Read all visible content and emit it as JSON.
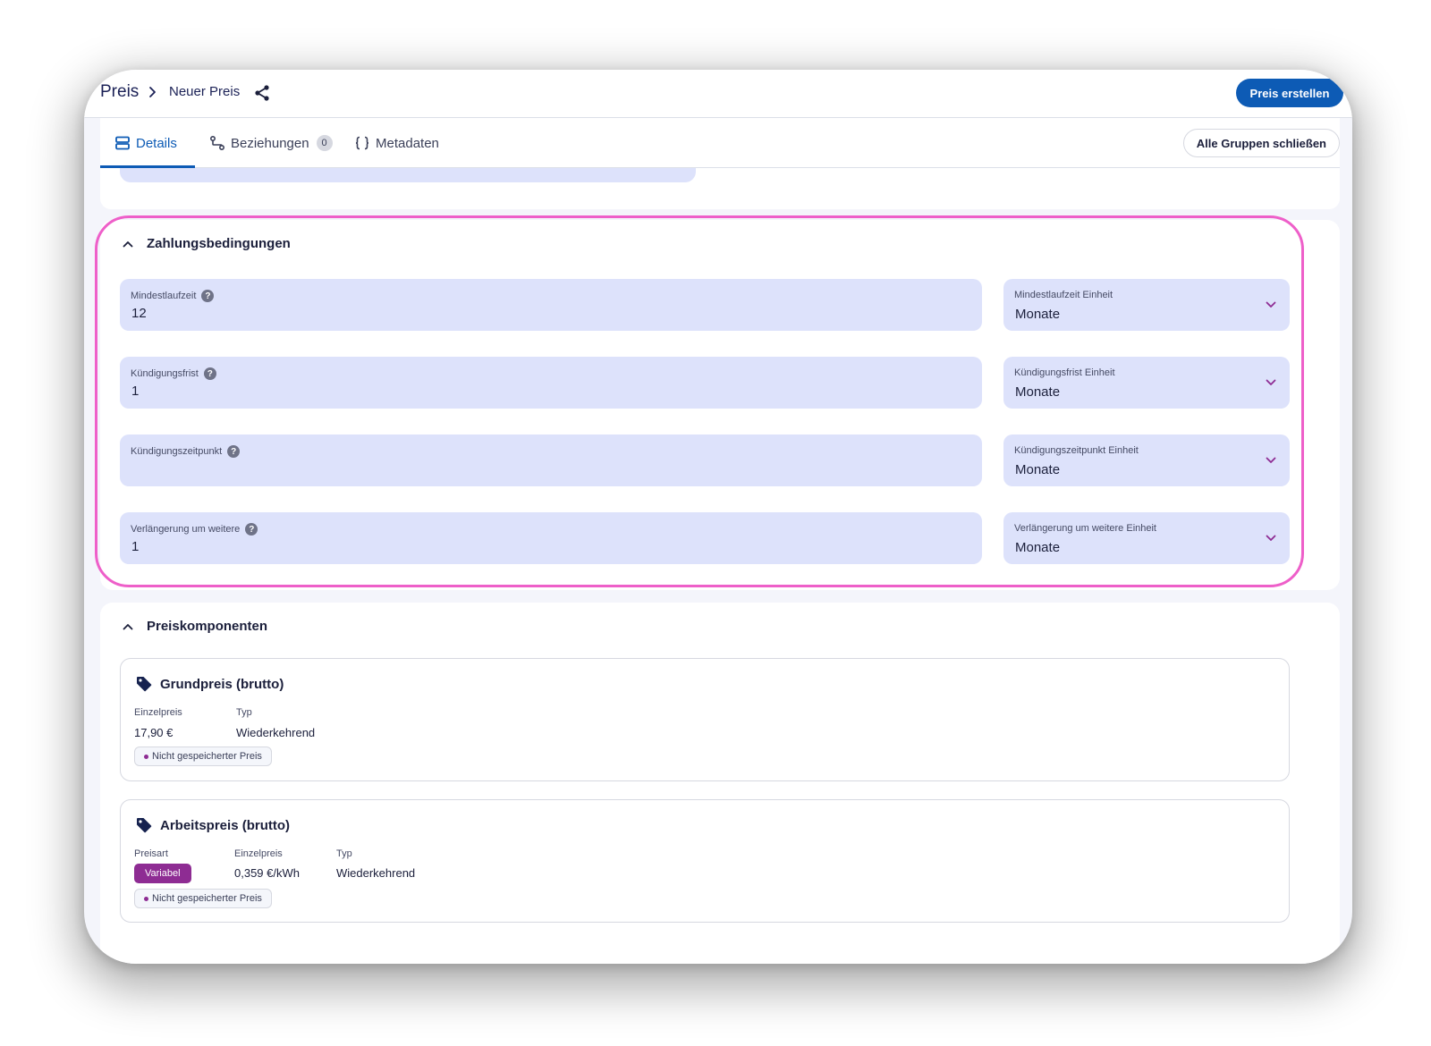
{
  "header": {
    "breadcrumb_root": "Preis",
    "breadcrumb_current": "Neuer Preis",
    "create_button": "Preis erstellen"
  },
  "tabs": [
    {
      "label": "Details",
      "icon": "rows-icon",
      "active": true
    },
    {
      "label": "Beziehungen",
      "icon": "relations-icon",
      "count": "0"
    },
    {
      "label": "Metadaten",
      "icon": "braces-icon"
    }
  ],
  "collapse_all_button": "Alle Gruppen schließen",
  "payment_section": {
    "title": "Zahlungsbedingungen",
    "fields": [
      {
        "label": "Mindestlaufzeit",
        "value": "12",
        "unit_label": "Mindestlaufzeit Einheit",
        "unit_value": "Monate"
      },
      {
        "label": "Kündigungsfrist",
        "value": "1",
        "unit_label": "Kündigungsfrist Einheit",
        "unit_value": "Monate"
      },
      {
        "label": "Kündigungszeitpunkt",
        "value": "",
        "unit_label": "Kündigungszeitpunkt Einheit",
        "unit_value": "Monate"
      },
      {
        "label": "Verlängerung um weitere",
        "value": "1",
        "unit_label": "Verlängerung um weitere Einheit",
        "unit_value": "Monate"
      }
    ],
    "help_glyph": "?"
  },
  "price_section": {
    "title": "Preiskomponenten",
    "components": [
      {
        "title": "Grundpreis (brutto)",
        "einzelpreis_label": "Einzelpreis",
        "einzelpreis_value": "17,90 €",
        "typ_label": "Typ",
        "typ_value": "Wiederkehrend",
        "status": "Nicht gespeicherter Preis"
      },
      {
        "title": "Arbeitspreis (brutto)",
        "preisart_label": "Preisart",
        "preisart_value": "Variabel",
        "einzelpreis_label": "Einzelpreis",
        "einzelpreis_value": "0,359 €/kWh",
        "typ_label": "Typ",
        "typ_value": "Wiederkehrend",
        "status": "Nicht gespeicherter Preis"
      }
    ]
  },
  "colors": {
    "primary": "#0d5bb5",
    "field_bg": "#dde2fb",
    "highlight": "#ee5fc9",
    "variabel": "#8e2c93"
  }
}
